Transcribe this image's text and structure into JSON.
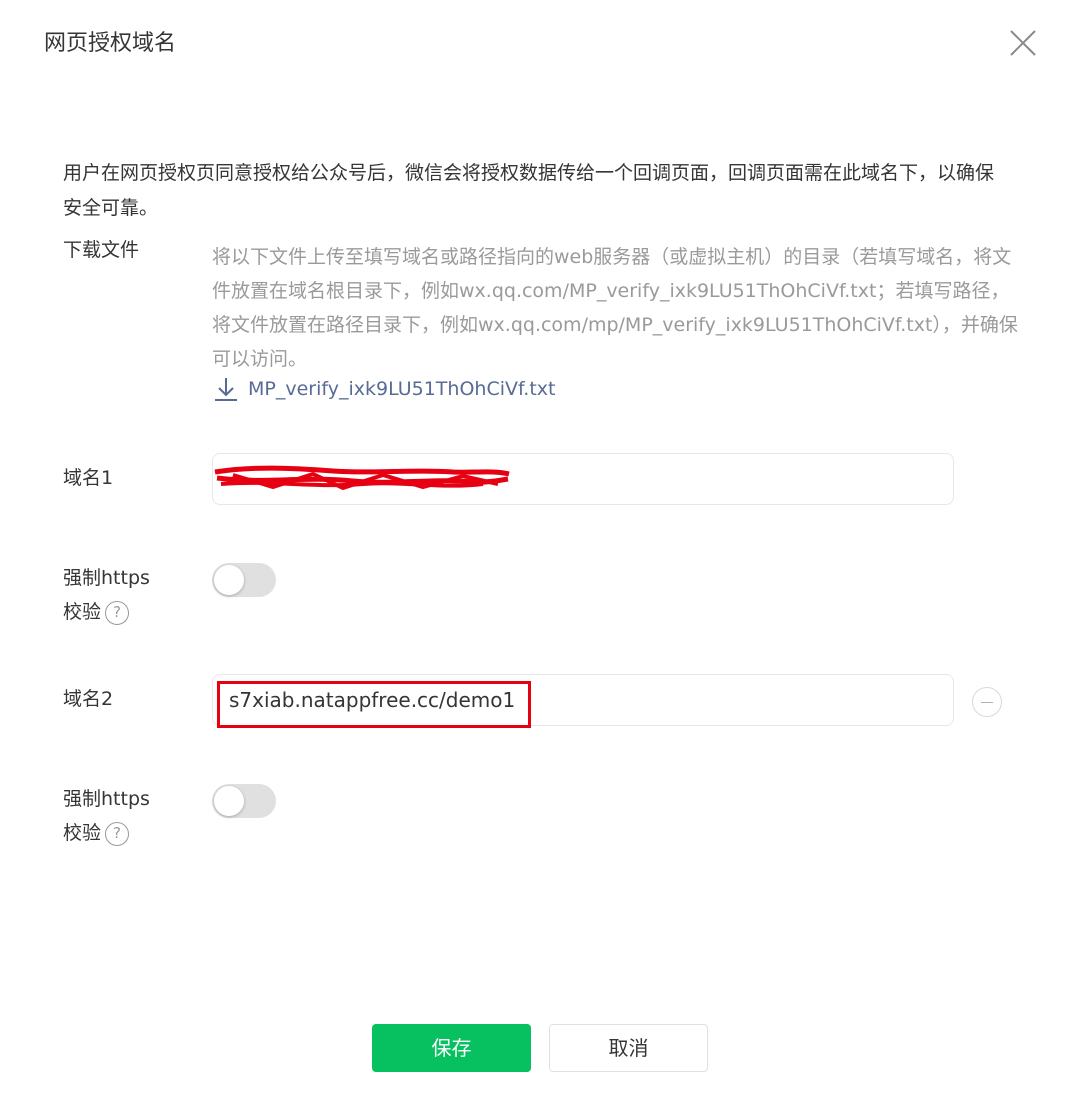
{
  "dialog": {
    "title": "网页授权域名",
    "intro": "用户在网页授权页同意授权给公众号后，微信会将授权数据传给一个回调页面，回调页面需在此域名下，以确保安全可靠。"
  },
  "download": {
    "label": "下载文件",
    "description": "将以下文件上传至填写域名或路径指向的web服务器（或虚拟主机）的目录（若填写域名，将文件放置在域名根目录下，例如wx.qq.com/MP_verify_ixk9LU51ThOhCiVf.txt；若填写路径，将文件放置在路径目录下，例如wx.qq.com/mp/MP_verify_ixk9LU51ThOhCiVf.txt），并确保可以访问。",
    "file_name": "MP_verify_ixk9LU51ThOhCiVf.txt"
  },
  "domain1": {
    "label": "域名1",
    "value": "",
    "https_label_line1": "强制https",
    "https_label_line2": "校验",
    "https_enabled": false
  },
  "domain2": {
    "label": "域名2",
    "value": "s7xiab.natappfree.cc/demo1",
    "https_label_line1": "强制https",
    "https_label_line2": "校验",
    "https_enabled": false
  },
  "help_glyph": "?",
  "buttons": {
    "save": "保存",
    "cancel": "取消"
  },
  "colors": {
    "primary": "#07c160",
    "link": "#576b95",
    "annotation": "#e60012"
  }
}
